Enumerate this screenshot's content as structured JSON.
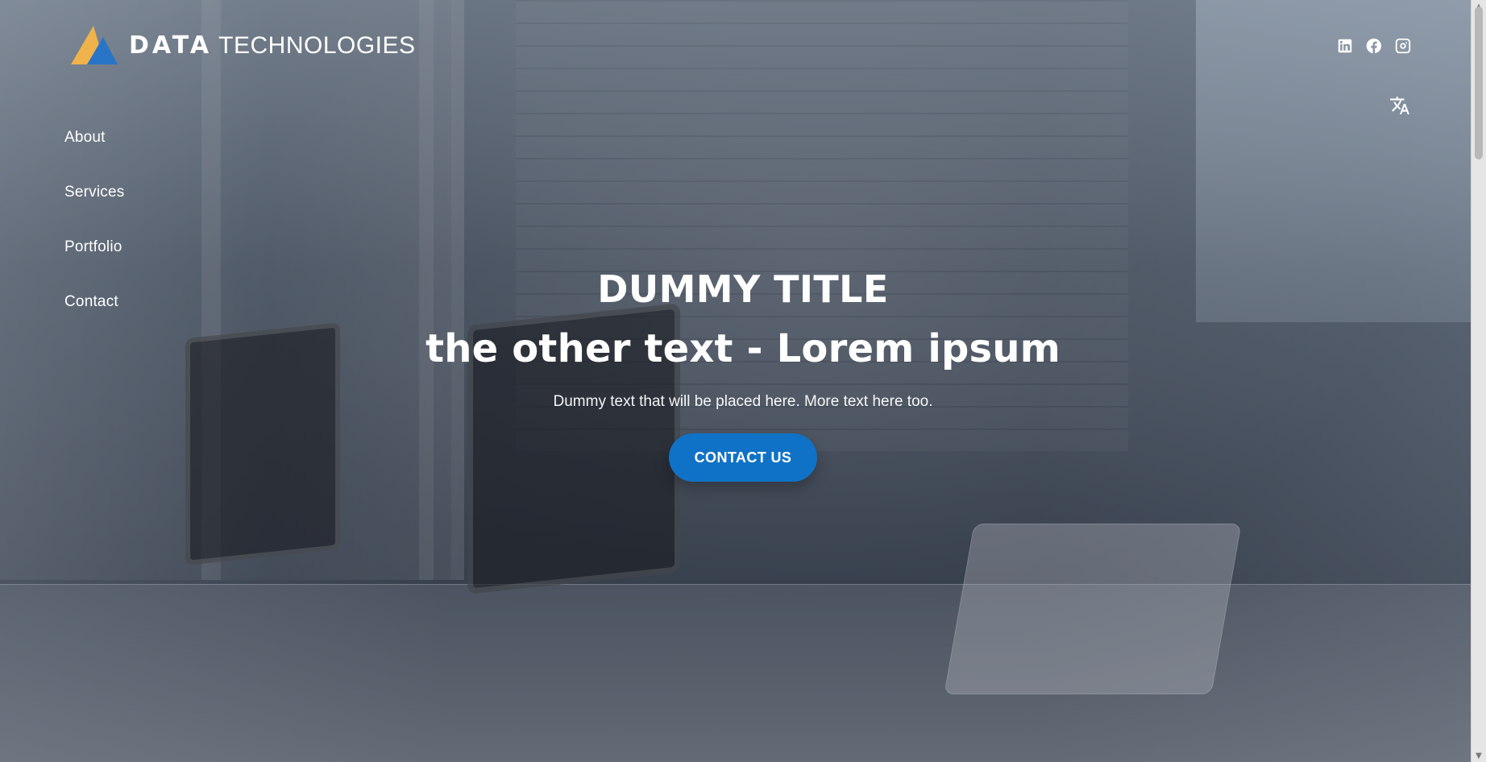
{
  "brand": {
    "name_part_1": "DATA",
    "name_part_2": "TECHNOLOGIES",
    "colors": {
      "logo_yellow": "#f0b24a",
      "logo_blue": "#2a74c7"
    }
  },
  "header": {
    "social": [
      {
        "name": "LinkedIn",
        "icon": "linkedin-icon"
      },
      {
        "name": "Facebook",
        "icon": "facebook-icon"
      },
      {
        "name": "Instagram",
        "icon": "instagram-icon"
      }
    ],
    "language_icon": "translate-icon"
  },
  "nav": {
    "items": [
      {
        "label": "About"
      },
      {
        "label": "Services"
      },
      {
        "label": "Portfolio"
      },
      {
        "label": "Contact"
      }
    ]
  },
  "hero": {
    "title": "DUMMY TITLE",
    "subtitle": "the other text - Lorem ipsum",
    "description": "Dummy text that will be placed here. More text here too.",
    "cta_label": "CONTACT US",
    "cta_color": "#1072c6"
  }
}
